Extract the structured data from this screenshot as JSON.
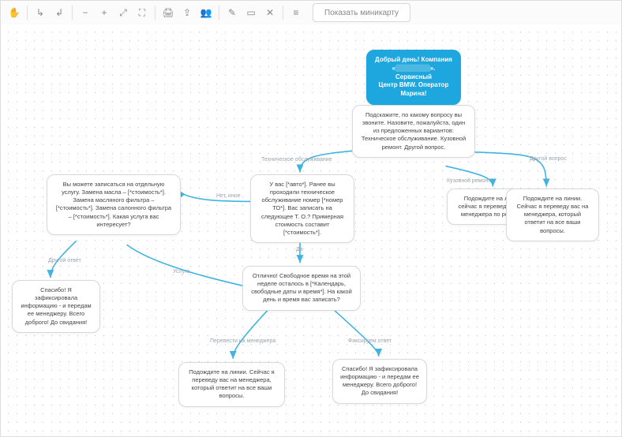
{
  "toolbar": {
    "minimap_btn": "Показать миникарту",
    "icons": [
      "hand",
      "branch-add",
      "branch-remove",
      "zoom-out",
      "zoom-in",
      "fit",
      "fullscreen",
      "print",
      "share",
      "people",
      "edit",
      "folder",
      "delete",
      "menu"
    ]
  },
  "edges": {
    "tech": "Техническое обслуживание",
    "body": "Кузовной ремонт",
    "other_q": "Другой вопрос",
    "no": "Нет, иное",
    "yes": "Да",
    "other_a": "Другой ответ",
    "service": "Услуга",
    "to_mgr": "Перевести на менеджера",
    "fix": "Фиксируем ответ"
  },
  "nodes": {
    "root_l1": "Добрый день! Компания",
    "root_l2_a": "«",
    "root_l2_b": "». Сервисный",
    "root_l3": "Центр BMW. Оператор",
    "root_l4": "Марина!",
    "root_redact": "████████",
    "ask": "Подскажите, по какому вопросу вы звоните. Назовите, пожалуйста, один из предложенных вариантов: Техническое обслуживание. Кузовной ремонт. Другой вопрос.",
    "car": "У вас [*авто*]. Ранее вы проходили техническое обслуживание номер [*номер ТО*]. Вас записать на следующее Т. О.? Примерная стоимость составит [*стоимость*].",
    "body_wait": "Подождите на линии. сейчас я переведу вас на менеджера по ремонту.",
    "other_wait": "Подождите на линии. Сейчас я переведу вас на менеджера, который ответит на все ваши вопросы.",
    "services": "Вы можете записаться на отдельную услугу. Замена масла – [*стоимость*]. Замена масляного фильтра – [*стоимость*]. Замена салонного фильтра – [*стоимость*]. Какая услуга вас интересует?",
    "thanks": "Спасибо! Я зафиксировала информацию  - и передам ее менеджеру. Всего доброго! До свидания!",
    "free": "Отлично! Свободное время на этой неделе осталось в [*Календарь, свободные даты и время*]. На какой день и время вас записать?",
    "mgr_wait": "Подождите на линии. Сейчас я переведу вас на менеджера, который ответит на все ваши вопросы.",
    "thanks2": "Спасибо! Я зафиксировала информацию  - и передам ее менеджеру. Всего доброго! До свидания!"
  }
}
